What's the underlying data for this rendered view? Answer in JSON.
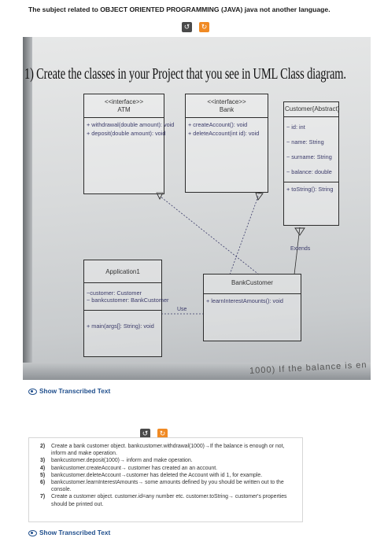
{
  "question": {
    "title": "The subject related to OBJECT ORIENTED PROGRAMMING (JAVA) java not another language."
  },
  "toolbar": {
    "undo_icon": "↺",
    "redo_icon": "↻"
  },
  "diagram_image": {
    "heading": "1) Create the classes in your Project that you see in UML Class diagram.",
    "atm": {
      "stereotype": "<<interface>>",
      "name": "ATM",
      "ops": [
        "+ withdrawal(double amount): void",
        "+ deposit(double amount): void"
      ]
    },
    "bank": {
      "stereotype": "<<interface>>",
      "name": "Bank",
      "ops": [
        "+ createAccount(): void",
        "+ deleteAccount(int id): void"
      ]
    },
    "customer": {
      "name": "Customer{Abstract}",
      "attrs": [
        "~ id: int",
        "~ name: String",
        "~ surname: String",
        "~ balance: double"
      ],
      "ops": [
        "+ toString(): String"
      ]
    },
    "application": {
      "name": "Application1",
      "attrs": [
        "~customer: Customer",
        "~ bankcustomer: BankCustomer"
      ],
      "ops": [
        "+ main(args[]: String): void"
      ]
    },
    "bankcustomer": {
      "name": "BankCustomer",
      "ops": [
        "+ learnInterestAmounts(): void"
      ]
    },
    "extends_label": "Extends",
    "use_label": "Use",
    "cutoff_text": "1000) If the balance is en"
  },
  "show_transcribed_label": "Show Transcribed Text",
  "tasks": [
    {
      "num": "2)",
      "text": "Create a bank customer object. bankcustomer.withdrawal(1000)→If the balance is enough or not, inform and make operation."
    },
    {
      "num": "3)",
      "text": "bankcustomer.deposit(1000)→ inform and make operation."
    },
    {
      "num": "4)",
      "text": "bankcustomer.createAccount→ customer has created an an account."
    },
    {
      "num": "5)",
      "text": "bankcustomer.deleteAccount→customer has deleted the Account with id 1, for example."
    },
    {
      "num": "6)",
      "text": "bankcustomer.learnInterestAmounts→ some amounts defined by you should be written out to the console."
    },
    {
      "num": "7)",
      "text": "Create a customer object. customer.id=any number etc. customer.toString→ customer's properties should be printed out."
    }
  ]
}
